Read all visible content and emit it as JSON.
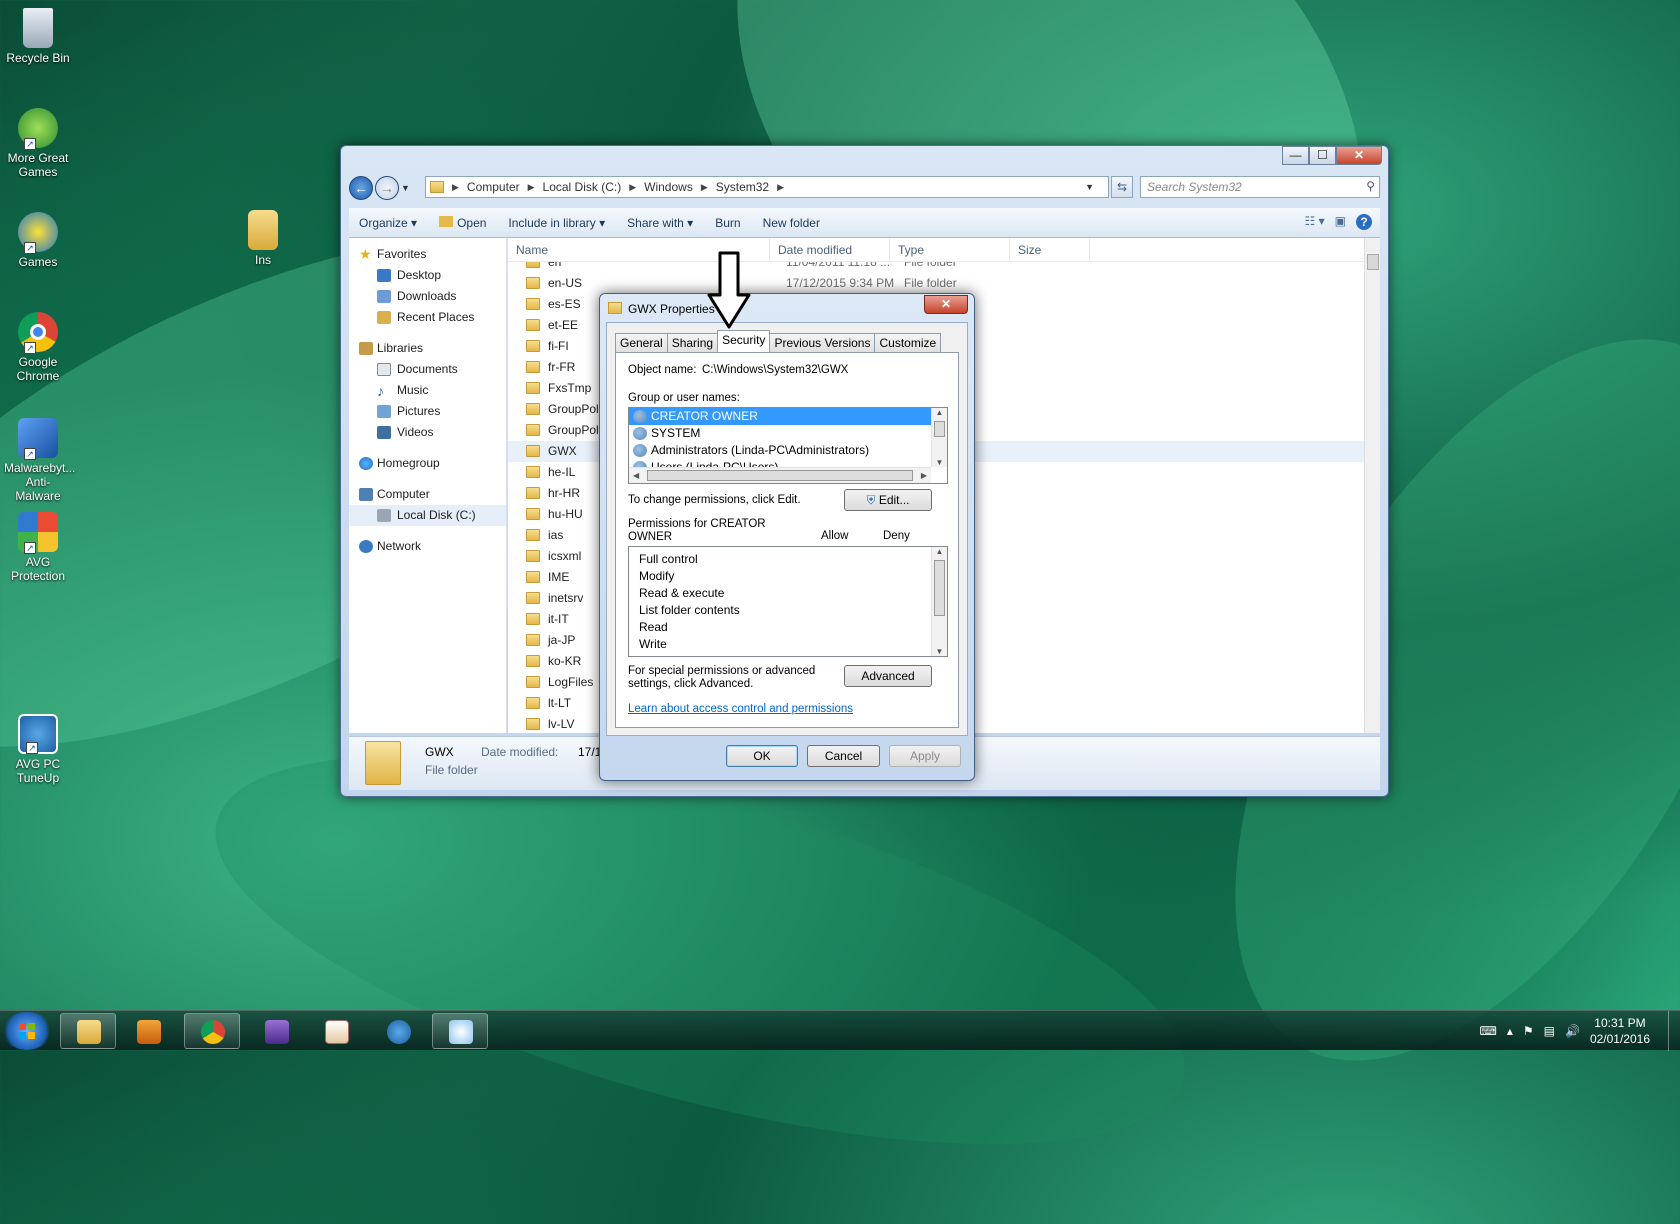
{
  "desktop": {
    "icons": [
      {
        "label": "Recycle Bin",
        "name": "recycle-bin-icon"
      },
      {
        "label": "More Great Games",
        "name": "more-great-games-icon"
      },
      {
        "label": "Games",
        "name": "games-icon"
      },
      {
        "label": "Google Chrome",
        "name": "google-chrome-icon"
      },
      {
        "label": "Malwarebyt... Anti-Malware",
        "name": "malwarebytes-icon"
      },
      {
        "label": "AVG Protection",
        "name": "avg-protection-icon"
      },
      {
        "label": "AVG PC TuneUp",
        "name": "avg-pc-tuneup-icon"
      },
      {
        "label": "Ins",
        "name": "ins-icon"
      }
    ]
  },
  "explorer": {
    "breadcrumb": [
      "Computer",
      "Local Disk (C:)",
      "Windows",
      "System32"
    ],
    "search_placeholder": "Search System32",
    "toolbar": {
      "organize": "Organize ▾",
      "open": "Open",
      "include": "Include in library ▾",
      "share": "Share with ▾",
      "burn": "Burn",
      "new_folder": "New folder"
    },
    "nav": {
      "favorites": "Favorites",
      "desktop": "Desktop",
      "downloads": "Downloads",
      "recent": "Recent Places",
      "libraries": "Libraries",
      "documents": "Documents",
      "music": "Music",
      "pictures": "Pictures",
      "videos": "Videos",
      "homegroup": "Homegroup",
      "computer": "Computer",
      "local_disk": "Local Disk (C:)",
      "network": "Network"
    },
    "columns": {
      "name": "Name",
      "date": "Date modified",
      "type": "Type",
      "size": "Size"
    },
    "files": [
      {
        "name": "en",
        "date": "11/04/2011 11:18 ...",
        "type": "File folder"
      },
      {
        "name": "en-US",
        "date": "17/12/2015 9:34 PM",
        "type": "File folder"
      },
      {
        "name": "es-ES",
        "date": "",
        "type": ""
      },
      {
        "name": "et-EE",
        "date": "",
        "type": ""
      },
      {
        "name": "fi-FI",
        "date": "",
        "type": ""
      },
      {
        "name": "fr-FR",
        "date": "",
        "type": ""
      },
      {
        "name": "FxsTmp",
        "date": "",
        "type": ""
      },
      {
        "name": "GroupPoli",
        "date": "",
        "type": ""
      },
      {
        "name": "GroupPoli",
        "date": "",
        "type": ""
      },
      {
        "name": "GWX",
        "date": "",
        "type": ""
      },
      {
        "name": "he-IL",
        "date": "",
        "type": ""
      },
      {
        "name": "hr-HR",
        "date": "",
        "type": ""
      },
      {
        "name": "hu-HU",
        "date": "",
        "type": ""
      },
      {
        "name": "ias",
        "date": "",
        "type": ""
      },
      {
        "name": "icsxml",
        "date": "",
        "type": ""
      },
      {
        "name": "IME",
        "date": "",
        "type": ""
      },
      {
        "name": "inetsrv",
        "date": "",
        "type": ""
      },
      {
        "name": "it-IT",
        "date": "",
        "type": ""
      },
      {
        "name": "ja-JP",
        "date": "",
        "type": ""
      },
      {
        "name": "ko-KR",
        "date": "",
        "type": ""
      },
      {
        "name": "LogFiles",
        "date": "",
        "type": ""
      },
      {
        "name": "lt-LT",
        "date": "",
        "type": ""
      },
      {
        "name": "lv-LV",
        "date": "",
        "type": ""
      }
    ],
    "details": {
      "name": "GWX",
      "date_label": "Date modified:",
      "date_value": "17/12/",
      "type": "File folder"
    }
  },
  "dialog": {
    "title": "GWX Properties",
    "tabs": [
      "General",
      "Sharing",
      "Security",
      "Previous Versions",
      "Customize"
    ],
    "object_label": "Object name:",
    "object_value": "C:\\Windows\\System32\\GWX",
    "group_label": "Group or user names:",
    "users": [
      "CREATOR OWNER",
      "SYSTEM",
      "Administrators (Linda-PC\\Administrators)",
      "Users (Linda-PC\\Users)"
    ],
    "change_text": "To change permissions, click Edit.",
    "edit_button": "Edit...",
    "perm_for": "Permissions for CREATOR OWNER",
    "allow": "Allow",
    "deny": "Deny",
    "permissions": [
      "Full control",
      "Modify",
      "Read & execute",
      "List folder contents",
      "Read",
      "Write"
    ],
    "special_text": "For special permissions or advanced settings, click Advanced.",
    "advanced_button": "Advanced",
    "learn_link": "Learn about access control and permissions",
    "ok": "OK",
    "cancel": "Cancel",
    "apply": "Apply"
  },
  "taskbar": {
    "time": "10:31 PM",
    "date": "02/01/2016"
  }
}
